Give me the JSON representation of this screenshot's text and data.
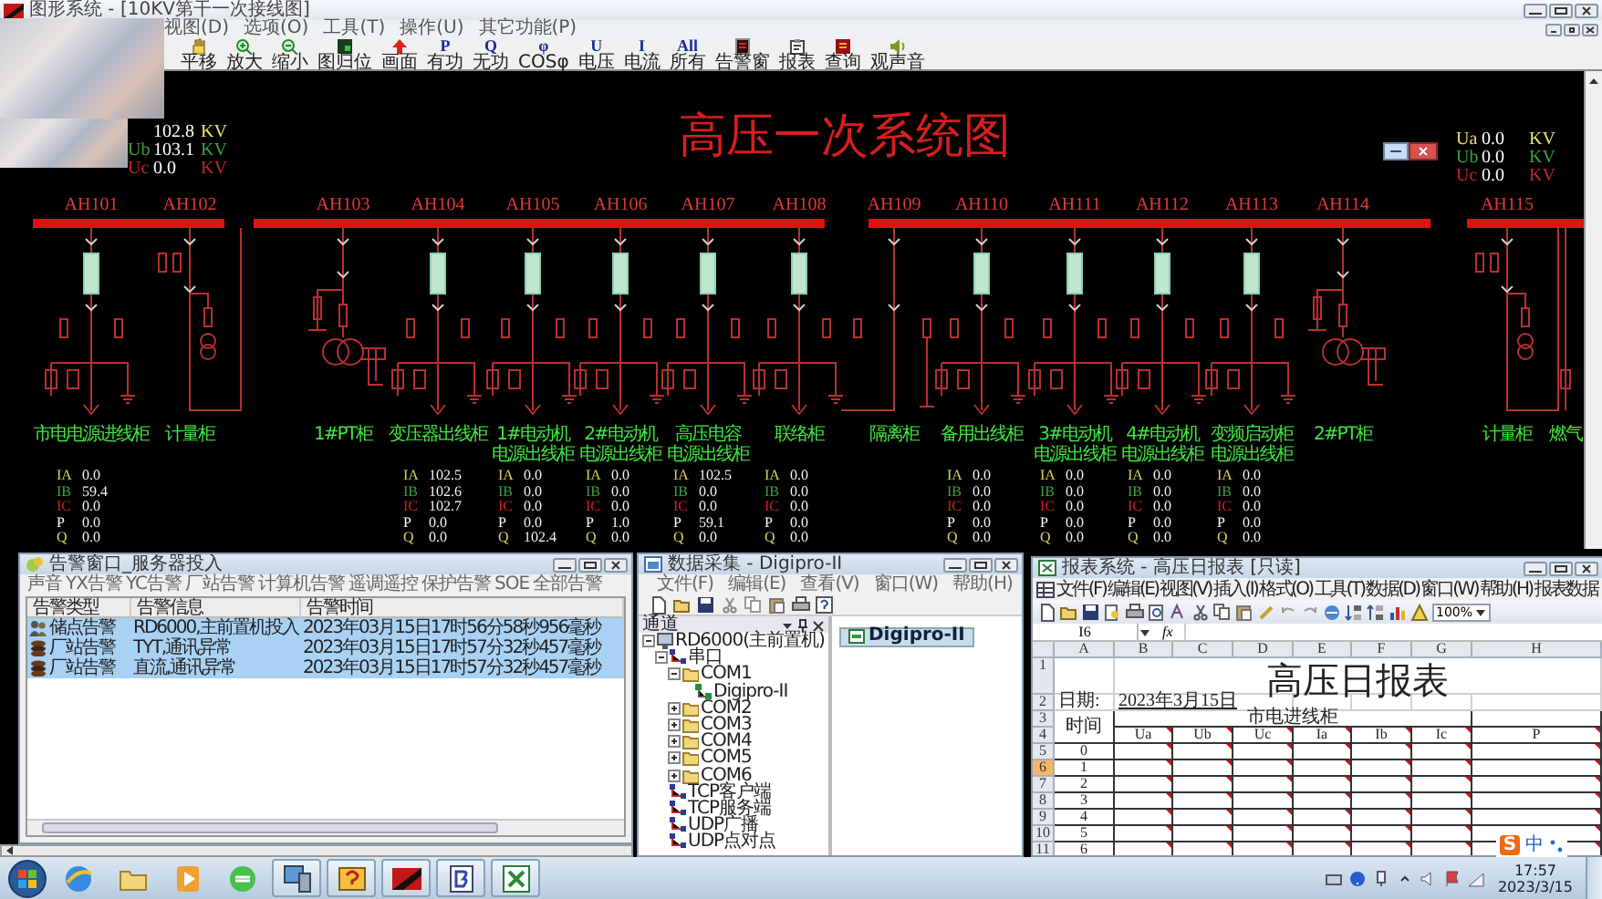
{
  "app": {
    "title": "图形系统 - [10KV第干一次接线图]",
    "menu": [
      "视图(D)",
      "选项(O)",
      "工具(T)",
      "操作(U)",
      "其它功能(P)"
    ],
    "toolbar": [
      {
        "label": "平移",
        "kind": "pan"
      },
      {
        "label": "放大",
        "kind": "zoomin"
      },
      {
        "label": "缩小",
        "kind": "zoomout"
      },
      {
        "label": "图归位",
        "kind": "home"
      },
      {
        "label": "画面",
        "kind": "arrow"
      },
      {
        "label": "有功",
        "kind": "glyph",
        "glyph": "P"
      },
      {
        "label": "无功",
        "kind": "glyph",
        "glyph": "Q"
      },
      {
        "label": "COSφ",
        "kind": "glyph",
        "glyph": "φ"
      },
      {
        "label": "电压",
        "kind": "glyph",
        "glyph": "U"
      },
      {
        "label": "电流",
        "kind": "glyph",
        "glyph": "I"
      },
      {
        "label": "所有",
        "kind": "glyph",
        "glyph": "All"
      },
      {
        "label": "告警窗",
        "kind": "alarm"
      },
      {
        "label": "报表",
        "kind": "report"
      },
      {
        "label": "查询",
        "kind": "query"
      },
      {
        "label": "观声音",
        "kind": "sound"
      }
    ]
  },
  "diagram": {
    "title": "高压一次系统图",
    "voltages_left": [
      {
        "value": "102.8",
        "unit": "KV",
        "color": "#e8e070"
      },
      {
        "label": "Ub",
        "value": "103.1",
        "unit": "KV",
        "color": "#3ca03c"
      },
      {
        "label": "Uc",
        "value": "0.0",
        "unit": "KV",
        "color": "#c02828"
      }
    ],
    "voltages_right": [
      {
        "label": "Ua",
        "value": "0.0",
        "unit": "KV",
        "color": "#e8e070"
      },
      {
        "label": "Ub",
        "value": "0.0",
        "unit": "KV",
        "color": "#3ca03c"
      },
      {
        "label": "Uc",
        "value": "0.0",
        "unit": "KV",
        "color": "#c02828"
      }
    ],
    "cabinets": [
      {
        "code": "AH101",
        "name": [
          "市电电源进线柜"
        ],
        "kind": "feeder",
        "readings": [
          {
            "label": "IA",
            "value": "0.0"
          },
          {
            "label": "IB",
            "value": "59.4"
          },
          {
            "label": "IC",
            "value": "0.0"
          },
          {
            "label": "P",
            "value": "0.0"
          },
          {
            "label": "Q",
            "value": "0.0"
          }
        ]
      },
      {
        "code": "AH102",
        "name": [
          "计量柜"
        ],
        "kind": "metering"
      },
      {
        "code": "AH103",
        "name": [
          "1#PT柜"
        ],
        "kind": "pt"
      },
      {
        "code": "AH104",
        "name": [
          "变压器出线柜"
        ],
        "kind": "feeder",
        "readings": [
          {
            "label": "IA",
            "value": "102.5"
          },
          {
            "label": "IB",
            "value": "102.6"
          },
          {
            "label": "IC",
            "value": "102.7"
          },
          {
            "label": "P",
            "value": "0.0"
          },
          {
            "label": "Q",
            "value": "0.0"
          }
        ]
      },
      {
        "code": "AH105",
        "name": [
          "1#电动机",
          "电源出线柜"
        ],
        "kind": "feeder",
        "readings": [
          {
            "label": "IA",
            "value": "0.0"
          },
          {
            "label": "IB",
            "value": "0.0"
          },
          {
            "label": "IC",
            "value": "0.0"
          },
          {
            "label": "P",
            "value": "0.0"
          },
          {
            "label": "Q",
            "value": "102.4"
          }
        ]
      },
      {
        "code": "AH106",
        "name": [
          "2#电动机",
          "电源出线柜"
        ],
        "kind": "feeder",
        "readings": [
          {
            "label": "IA",
            "value": "0.0"
          },
          {
            "label": "IB",
            "value": "0.0"
          },
          {
            "label": "IC",
            "value": "0.0"
          },
          {
            "label": "P",
            "value": "1.0"
          },
          {
            "label": "Q",
            "value": "0.0"
          }
        ]
      },
      {
        "code": "AH107",
        "name": [
          "高压电容",
          "电源出线柜"
        ],
        "kind": "feeder",
        "readings": [
          {
            "label": "IA",
            "value": "102.5"
          },
          {
            "label": "IB",
            "value": "0.0"
          },
          {
            "label": "IC",
            "value": "0.0"
          },
          {
            "label": "P",
            "value": "59.1"
          },
          {
            "label": "Q",
            "value": "0.0"
          }
        ]
      },
      {
        "code": "AH108",
        "name": [
          "联络柜"
        ],
        "kind": "feeder",
        "readings": [
          {
            "label": "IA",
            "value": "0.0"
          },
          {
            "label": "IB",
            "value": "0.0"
          },
          {
            "label": "IC",
            "value": "0.0"
          },
          {
            "label": "P",
            "value": "0.0"
          },
          {
            "label": "Q",
            "value": "0.0"
          }
        ]
      },
      {
        "code": "AH109",
        "name": [
          "隔离柜"
        ],
        "kind": "isolation"
      },
      {
        "code": "AH110",
        "name": [
          "备用出线柜"
        ],
        "kind": "feeder",
        "readings": [
          {
            "label": "IA",
            "value": "0.0"
          },
          {
            "label": "IB",
            "value": "0.0"
          },
          {
            "label": "IC",
            "value": "0.0"
          },
          {
            "label": "P",
            "value": "0.0"
          },
          {
            "label": "Q",
            "value": "0.0"
          }
        ]
      },
      {
        "code": "AH111",
        "name": [
          "3#电动机",
          "电源出线柜"
        ],
        "kind": "feeder",
        "readings": [
          {
            "label": "IA",
            "value": "0.0"
          },
          {
            "label": "IB",
            "value": "0.0"
          },
          {
            "label": "IC",
            "value": "0.0"
          },
          {
            "label": "P",
            "value": "0.0"
          },
          {
            "label": "Q",
            "value": "0.0"
          }
        ]
      },
      {
        "code": "AH112",
        "name": [
          "4#电动机",
          "电源出线柜"
        ],
        "kind": "feeder",
        "readings": [
          {
            "label": "IA",
            "value": "0.0"
          },
          {
            "label": "IB",
            "value": "0.0"
          },
          {
            "label": "IC",
            "value": "0.0"
          },
          {
            "label": "P",
            "value": "0.0"
          },
          {
            "label": "Q",
            "value": "0.0"
          }
        ]
      },
      {
        "code": "AH113",
        "name": [
          "变频启动柜",
          "电源出线柜"
        ],
        "kind": "feeder",
        "readings": [
          {
            "label": "IA",
            "value": "0.0"
          },
          {
            "label": "IB",
            "value": "0.0"
          },
          {
            "label": "IC",
            "value": "0.0"
          },
          {
            "label": "P",
            "value": "0.0"
          },
          {
            "label": "Q",
            "value": "0.0"
          }
        ]
      },
      {
        "code": "AH114",
        "name": [
          "2#PT柜"
        ],
        "kind": "pt"
      },
      {
        "code": "AH115",
        "name": [
          "计量柜"
        ],
        "kind": "metering"
      },
      {
        "name": [
          "燃气"
        ],
        "kind": "partial"
      }
    ]
  },
  "alarm_window": {
    "title": "告警窗口_服务器投入",
    "menu": [
      "声音",
      "YX告警",
      "YC告警",
      "厂站告警",
      "计算机告警",
      "遥调遥控",
      "保护告警",
      "SOE",
      "全部告警"
    ],
    "columns": [
      "告警类型",
      "告警信息",
      "告警时间"
    ],
    "rows": [
      {
        "kind": "node",
        "type": "储点告警",
        "info": "RD6000,主前置机投入",
        "time": "2023年03月15日17时56分58秒956毫秒",
        "selected": true
      },
      {
        "kind": "station",
        "type": "厂站告警",
        "info": "TYT,通讯异常",
        "time": "2023年03月15日17时57分32秒457毫秒",
        "selected": true
      },
      {
        "kind": "station",
        "type": "厂站告警",
        "info": "直流,通讯异常",
        "time": "2023年03月15日17时57分32秒457毫秒",
        "selected": true
      }
    ]
  },
  "collector": {
    "title": "数据采集 - Digipro-II",
    "menu": [
      "文件(F)",
      "编辑(E)",
      "查看(V)",
      "窗口(W)",
      "帮助(H)"
    ],
    "pane_title": "通道",
    "tree": [
      {
        "label": "RD6000(主前置机)",
        "kind": "computer",
        "expanded": true,
        "children": [
          {
            "label": "串口",
            "kind": "net",
            "expanded": true,
            "children": [
              {
                "label": "COM1",
                "kind": "folder",
                "expanded": true,
                "children": [
                  {
                    "label": "Digipro-II",
                    "kind": "device"
                  }
                ]
              },
              {
                "label": "COM2",
                "kind": "folder",
                "expanded": false
              },
              {
                "label": "COM3",
                "kind": "folder",
                "expanded": false
              },
              {
                "label": "COM4",
                "kind": "folder",
                "expanded": false
              },
              {
                "label": "COM5",
                "kind": "folder",
                "expanded": false
              },
              {
                "label": "COM6",
                "kind": "folder",
                "expanded": false
              }
            ]
          },
          {
            "label": "TCP客户端",
            "kind": "net"
          },
          {
            "label": "TCP服务端",
            "kind": "net"
          },
          {
            "label": "UDP广播",
            "kind": "net"
          },
          {
            "label": "UDP点对点",
            "kind": "net"
          }
        ]
      }
    ],
    "tab": "Digipro-II"
  },
  "report": {
    "title": "报表系统 - 高压日报表 [只读]",
    "menu": [
      "文件(F)",
      "编辑(E)",
      "视图(V)",
      "插入(I)",
      "格式(O)",
      "工具(T)",
      "数据(D)",
      "窗口(W)",
      "帮助(H)",
      "报表数据"
    ],
    "zoom": "100%",
    "cell_ref": "I6",
    "formula_label": "fx",
    "columns": [
      "A",
      "B",
      "C",
      "D",
      "E",
      "F",
      "G",
      "H"
    ],
    "header_rows": [
      "1",
      "2",
      "3",
      "4"
    ],
    "sheet_title": "高压日报表",
    "date_label": "日期:",
    "date": "2023年3月15日",
    "time_header": "时间",
    "group_header": "市电进线柜",
    "sub_headers": [
      "Ua",
      "Ub",
      "Uc",
      "Ia",
      "Ib",
      "Ic",
      "P"
    ],
    "comment_marks": true,
    "rows": [
      {
        "number": "5",
        "time": "0",
        "selected": false
      },
      {
        "number": "6",
        "time": "1",
        "selected": true
      },
      {
        "number": "7",
        "time": "2",
        "selected": false
      },
      {
        "number": "8",
        "time": "3",
        "selected": false
      },
      {
        "number": "9",
        "time": "4",
        "selected": false
      },
      {
        "number": "10",
        "time": "5",
        "selected": false
      },
      {
        "number": "11",
        "time": "6",
        "selected": false
      }
    ]
  },
  "ime": {
    "logo": "S",
    "mode": "中"
  },
  "taskbar": {
    "time": "17:57",
    "date": "2023/3/15"
  }
}
